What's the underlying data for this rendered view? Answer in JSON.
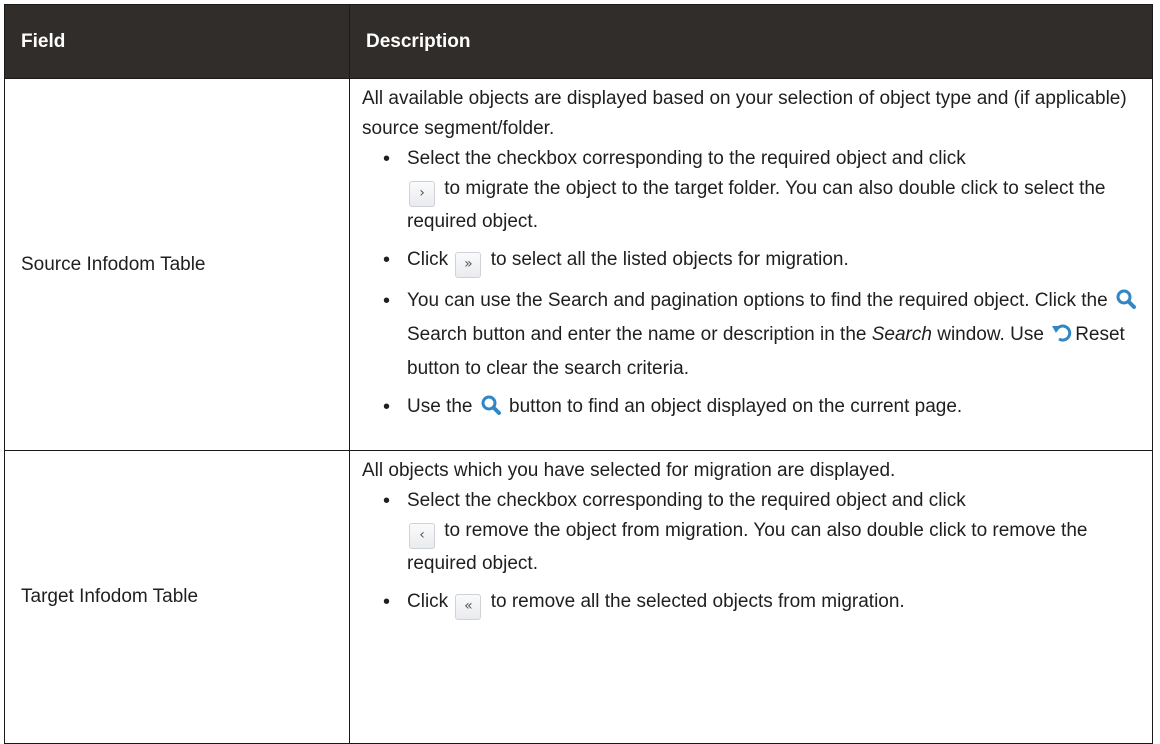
{
  "header": {
    "field": "Field",
    "description": "Description"
  },
  "rows": [
    {
      "field": "Source Infodom Table",
      "intro": "All available objects are displayed based on your selection of object type and (if applicable) source segment/folder.",
      "b1_pre": "Select the checkbox corresponding to the required object and click",
      "b1_post": "to migrate the object to the target folder. You can also double click to select the required object.",
      "b2_pre": "Click",
      "b2_post": "to select all the listed objects for migration.",
      "b3_a": "You can use the Search and pagination options to find the required object. Click the",
      "b3_b": "Search button and enter the name or description in the",
      "b3_em": "Search",
      "b3_c": "window. Use",
      "b3_d": "Reset button to clear the search criteria.",
      "b4_pre": "Use the",
      "b4_post": "button to find an object displayed on the current page."
    },
    {
      "field": "Target Infodom Table",
      "intro": "All objects which you have selected for migration are displayed.",
      "b1_pre": "Select the checkbox corresponding to the required object and click",
      "b1_post": "to remove the object from migration. You can also double click to remove the required object.",
      "b2_pre": "Click",
      "b2_post": "to remove all the selected objects from migration."
    }
  ],
  "icons": {
    "move_right": "chevron-right-icon",
    "move_all_right": "double-chevron-right-icon",
    "search": "search-icon",
    "reset": "reset-icon",
    "move_left": "chevron-left-icon",
    "move_all_left": "double-chevron-left-icon",
    "icon_color": "#2f87c6",
    "header_bg": "#312d2a"
  }
}
